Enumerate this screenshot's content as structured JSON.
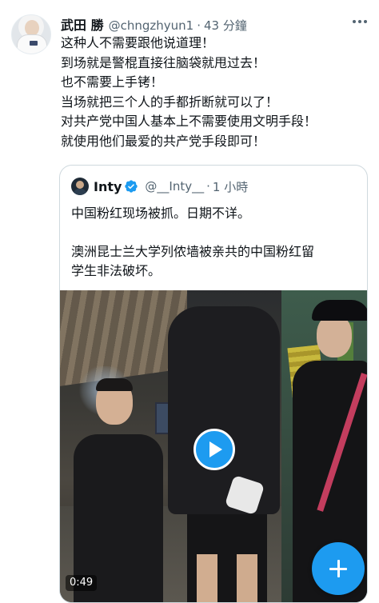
{
  "tweet": {
    "author": {
      "display_name": "武田 勝",
      "handle": "@chngzhyun1",
      "time": "43 分鐘"
    },
    "separator": "·",
    "lines": [
      "这种人不需要跟他说道理！",
      "到场就是警棍直接往脑袋就甩过去！",
      "也不需要上手铐！",
      "当场就把三个人的手都折断就可以了！",
      "对共产党中国人基本上不需要使用文明手段！",
      "就使用他们最爱的共产党手段即可！"
    ],
    "more_icon": "more-horizontal-icon"
  },
  "quote": {
    "author": {
      "display_name": "Inty",
      "handle": "@__Inty__",
      "time": "1 小時",
      "verified": true
    },
    "separator": "·",
    "text_line_1": "中国粉红现场被抓。日期不详。",
    "text_line_2": "澳洲昆士兰大学列侬墙被亲共的中国粉红留",
    "text_line_3": "学生非法破坏。",
    "video": {
      "duration": "0:49",
      "play_icon": "play-icon"
    }
  },
  "fab": {
    "icon": "plus-icon"
  },
  "colors": {
    "accent": "#1d9bf0",
    "text": "#0f1419",
    "secondary": "#536471",
    "border": "#cfd9de"
  }
}
